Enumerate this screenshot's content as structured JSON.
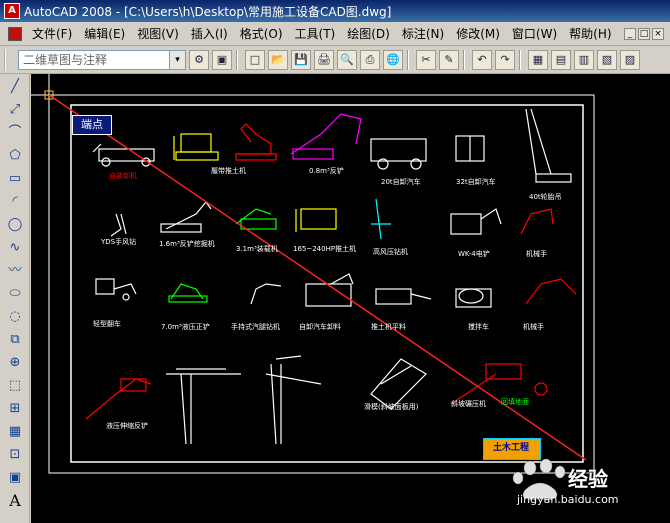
{
  "window": {
    "title": "AutoCAD 2008 - [C:\\Users\\h\\Desktop\\常用施工设备CAD图.dwg]",
    "app_icon_letter": "A"
  },
  "menu": {
    "items": [
      "文件(F)",
      "编辑(E)",
      "视图(V)",
      "插入(I)",
      "格式(O)",
      "工具(T)",
      "绘图(D)",
      "标注(N)",
      "修改(M)",
      "窗口(W)",
      "帮助(H)"
    ],
    "window_buttons": [
      "_",
      "□",
      "×"
    ]
  },
  "toolbar": {
    "workspace_value": "二维草图与注释",
    "dropdown_arrow": "▾",
    "tool_glyphs": [
      "⚙",
      "▣",
      "□",
      "📂",
      "💾",
      "🖨",
      "🔍",
      "⎙",
      "🌐",
      "✂",
      "✎",
      "↶",
      "↷",
      "▦",
      "▤",
      "▥",
      "▧",
      "▨"
    ]
  },
  "draw_tools": {
    "glyphs": [
      "╱",
      "⤢",
      "⌒",
      "⬠",
      "▭",
      "◜",
      "◯",
      "∿",
      "〰",
      "⬭",
      "◌",
      "⧉",
      "⊕",
      "⬚",
      "⊞",
      "▦",
      "⊡",
      "▣",
      "▥"
    ],
    "text_tool": "A"
  },
  "drawing": {
    "tooltip": "端点",
    "labels": [
      {
        "text": "自装卸机",
        "color": "red",
        "col": 0,
        "row": 0
      },
      {
        "text": "履带推土机",
        "color": "white",
        "col": 2,
        "row": 0
      },
      {
        "text": "0.8m³反铲",
        "color": "white",
        "col": 3,
        "row": 0
      },
      {
        "text": "20t自卸汽车",
        "color": "white",
        "col": 4,
        "row": 0
      },
      {
        "text": "32t自卸汽车",
        "color": "white",
        "col": 5,
        "row": 0
      },
      {
        "text": "40t轮胎吊",
        "color": "white",
        "col": 6,
        "row": 0
      },
      {
        "text": "YDS手风钻",
        "color": "white",
        "col": 0,
        "row": 1
      },
      {
        "text": "1.6m³反铲挖掘机",
        "color": "white",
        "col": 1,
        "row": 1
      },
      {
        "text": "3.1m³装载机",
        "color": "white",
        "col": 2,
        "row": 1
      },
      {
        "text": "165~240HP推土机",
        "color": "white",
        "col": 3,
        "row": 1
      },
      {
        "text": "高风压钻机",
        "color": "white",
        "col": 4,
        "row": 1
      },
      {
        "text": "WK-4电铲",
        "color": "white",
        "col": 5,
        "row": 1
      },
      {
        "text": "机械手",
        "color": "white",
        "col": 6,
        "row": 1
      },
      {
        "text": "轻型翻车",
        "color": "white",
        "col": 0,
        "row": 2
      },
      {
        "text": "7.0m³液压正铲",
        "color": "white",
        "col": 1,
        "row": 2
      },
      {
        "text": "手持式汽腿钻机",
        "color": "white",
        "col": 2,
        "row": 2
      },
      {
        "text": "自卸汽车卸料",
        "color": "white",
        "col": 3,
        "row": 2
      },
      {
        "text": "推土机平料",
        "color": "white",
        "col": 4,
        "row": 2
      },
      {
        "text": "搅拌车",
        "color": "white",
        "col": 5,
        "row": 2
      },
      {
        "text": "机械手",
        "color": "white",
        "col": 6,
        "row": 2
      },
      {
        "text": "液压伸缩反铲",
        "color": "white",
        "col": 0,
        "row": 3
      },
      {
        "text": "滑模(斜坡面板用)",
        "color": "white",
        "col": 4,
        "row": 3
      },
      {
        "text": "斜坡碾压机",
        "color": "white",
        "col": 5,
        "row": 3
      }
    ],
    "logo_text": "土木工程",
    "note_green": "回填地面"
  },
  "watermark": {
    "brand": "经验",
    "url": "jingyan.baidu.com"
  },
  "colors": {
    "canvas_bg": "#000000",
    "title_bar": "#0a246a",
    "red_line": "#ff2020"
  }
}
